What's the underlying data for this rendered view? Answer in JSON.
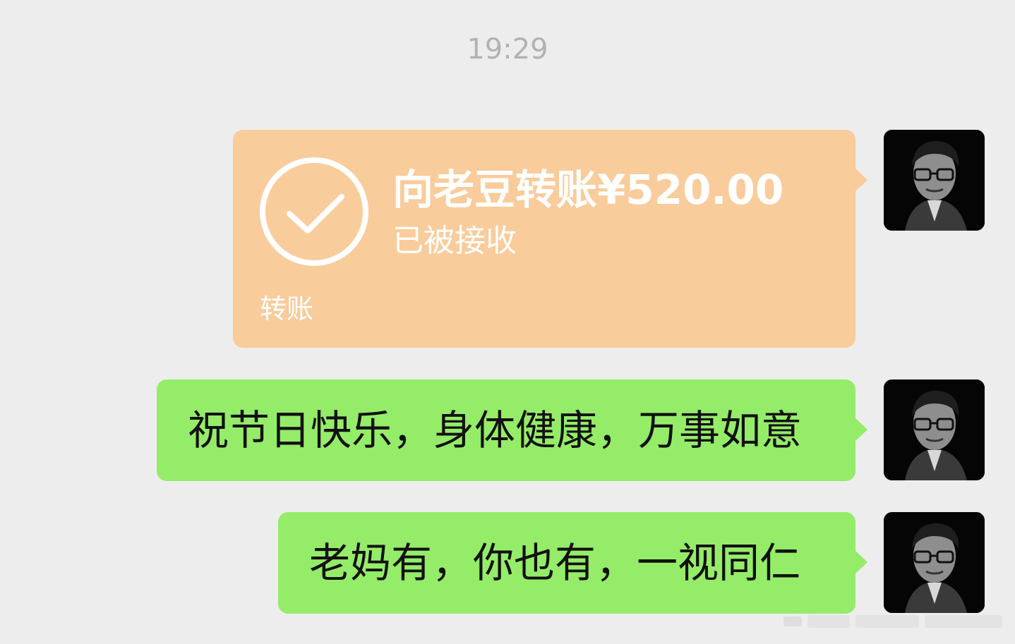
{
  "chat": {
    "timestamp": "19:29",
    "transfer": {
      "title": "向老豆转账¥520.00",
      "status": "已被接收",
      "footer": "转账",
      "icon": "check-circle-icon"
    },
    "messages": [
      {
        "text": "祝节日快乐，身体健康，万事如意"
      },
      {
        "text": "老妈有，你也有，一视同仁"
      }
    ]
  },
  "colors": {
    "background": "#ededed",
    "transfer_card": "#f9cc9c",
    "sent_bubble": "#95ec69",
    "timestamp_text": "#b2b2b2"
  }
}
